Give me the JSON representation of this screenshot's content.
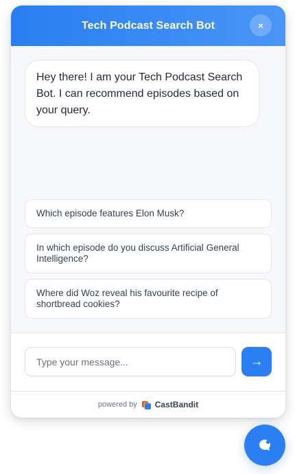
{
  "header": {
    "title": "Tech Podcast Search Bot",
    "close_label": "×"
  },
  "messages": [
    {
      "from": "bot",
      "text": "Hey there! I am your Tech Podcast Search Bot. I can recommend episodes based on your query."
    }
  ],
  "suggestions": [
    "Which episode features Elon Musk?",
    "In which episode do you discuss Artificial General Intelligence?",
    "Where did Woz reveal his favourite recipe of shortbread cookies?"
  ],
  "composer": {
    "placeholder": "Type your message...",
    "value": "",
    "send_label": "→"
  },
  "footer": {
    "powered_by": "powered by",
    "brand": "CastBandit"
  },
  "icons": {
    "close": "close-icon",
    "send": "arrow-right-icon",
    "brand_logo": "castbandit-logo-icon",
    "launcher": "chat-bubble-icon"
  },
  "colors": {
    "accent": "#2b7ff0",
    "header_gradient_start": "#2a7ef0",
    "header_gradient_end": "#4a96f6",
    "panel_bg": "#f6f8fb"
  }
}
